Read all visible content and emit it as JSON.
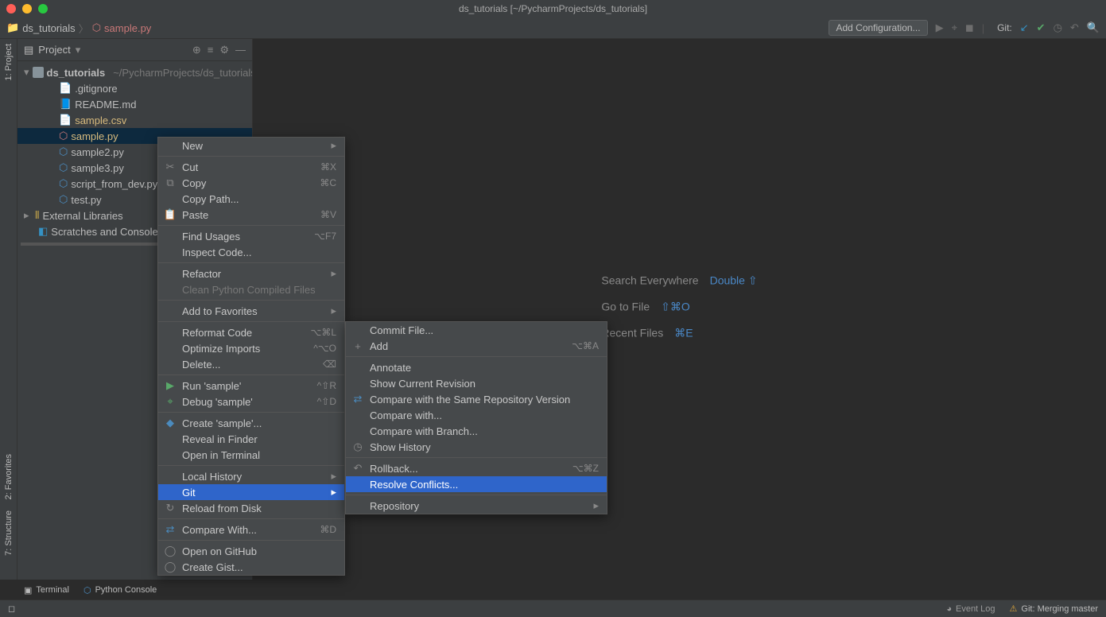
{
  "title": "ds_tutorials [~/PycharmProjects/ds_tutorials]",
  "breadcrumb": {
    "proj": "ds_tutorials",
    "file": "sample.py"
  },
  "toolbar": {
    "config": "Add Configuration...",
    "git": "Git:"
  },
  "project_pane": {
    "title": "Project"
  },
  "tree": {
    "root": "ds_tutorials",
    "root_path": "~/PycharmProjects/ds_tutorials",
    "files": [
      ".gitignore",
      "README.md",
      "sample.csv",
      "sample.py",
      "sample2.py",
      "sample3.py",
      "script_from_dev.py",
      "test.py"
    ],
    "ext": "External Libraries",
    "scr": "Scratches and Consoles"
  },
  "hints": [
    {
      "l": "Search Everywhere",
      "k": "Double ⇧"
    },
    {
      "l": "Go to File",
      "k": "⇧⌘O"
    },
    {
      "l": "Recent Files",
      "k": "⌘E"
    }
  ],
  "left_tabs": [
    "1: Project",
    "2: Favorites",
    "7: Structure"
  ],
  "bottom_tabs": [
    "Terminal",
    "Python Console"
  ],
  "menu1": [
    {
      "l": "New",
      "sub": true
    },
    {
      "sep": true
    },
    {
      "i": "✂",
      "l": "Cut",
      "s": "⌘X"
    },
    {
      "i": "⧉",
      "l": "Copy",
      "s": "⌘C"
    },
    {
      "l": "Copy Path..."
    },
    {
      "i": "📋",
      "l": "Paste",
      "s": "⌘V"
    },
    {
      "sep": true
    },
    {
      "l": "Find Usages",
      "s": "⌥F7"
    },
    {
      "l": "Inspect Code..."
    },
    {
      "sep": true
    },
    {
      "l": "Refactor",
      "sub": true
    },
    {
      "l": "Clean Python Compiled Files",
      "dis": true
    },
    {
      "sep": true
    },
    {
      "l": "Add to Favorites",
      "sub": true
    },
    {
      "sep": true
    },
    {
      "l": "Reformat Code",
      "s": "⌥⌘L"
    },
    {
      "l": "Optimize Imports",
      "s": "^⌥O"
    },
    {
      "l": "Delete...",
      "s": "⌫"
    },
    {
      "sep": true
    },
    {
      "i": "▶",
      "l": "Run 'sample'",
      "s": "^⇧R",
      "ic": "#59a869"
    },
    {
      "i": "⌖",
      "l": "Debug 'sample'",
      "s": "^⇧D",
      "ic": "#59a869"
    },
    {
      "sep": true
    },
    {
      "i": "◆",
      "l": "Create 'sample'...",
      "ic": "#4b8bbe"
    },
    {
      "l": "Reveal in Finder"
    },
    {
      "l": "Open in Terminal"
    },
    {
      "sep": true
    },
    {
      "l": "Local History",
      "sub": true
    },
    {
      "l": "Git",
      "sub": true,
      "sel": true
    },
    {
      "i": "↻",
      "l": "Reload from Disk"
    },
    {
      "sep": true
    },
    {
      "i": "⇄",
      "l": "Compare With...",
      "s": "⌘D",
      "ic": "#4b8bbe"
    },
    {
      "sep": true
    },
    {
      "i": "◯",
      "l": "Open on GitHub"
    },
    {
      "i": "◯",
      "l": "Create Gist..."
    }
  ],
  "menu2": [
    {
      "l": "Commit File..."
    },
    {
      "i": "+",
      "l": "Add",
      "s": "⌥⌘A"
    },
    {
      "sep": true
    },
    {
      "l": "Annotate"
    },
    {
      "l": "Show Current Revision"
    },
    {
      "i": "⇄",
      "l": "Compare with the Same Repository Version",
      "ic": "#4b8bbe"
    },
    {
      "l": "Compare with..."
    },
    {
      "l": "Compare with Branch..."
    },
    {
      "i": "◷",
      "l": "Show History"
    },
    {
      "sep": true
    },
    {
      "i": "↶",
      "l": "Rollback...",
      "s": "⌥⌘Z"
    },
    {
      "l": "Resolve Conflicts...",
      "sel": true
    },
    {
      "sep": true
    },
    {
      "l": "Repository",
      "sub": true
    }
  ],
  "status": {
    "git": "Git: Merging master",
    "event": "Event Log"
  }
}
